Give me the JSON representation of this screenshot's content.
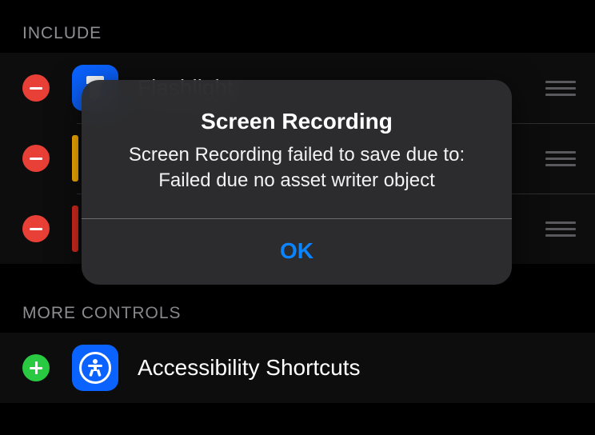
{
  "sections": {
    "include": {
      "header": "INCLUDE",
      "items": [
        {
          "label": "Flashlight",
          "icon": "flashlight",
          "iconColor": "#0a62ff"
        },
        {
          "label": "",
          "icon": "",
          "iconColor": "#ffb300"
        },
        {
          "label": "",
          "icon": "",
          "iconColor": "#d92b20"
        }
      ]
    },
    "more": {
      "header": "MORE CONTROLS",
      "items": [
        {
          "label": "Accessibility Shortcuts",
          "icon": "accessibility",
          "iconColor": "#0a62ff"
        }
      ]
    }
  },
  "alert": {
    "title": "Screen Recording",
    "message_line1": "Screen Recording failed to save due to:",
    "message_line2": "Failed due no asset writer object",
    "ok": "OK"
  }
}
